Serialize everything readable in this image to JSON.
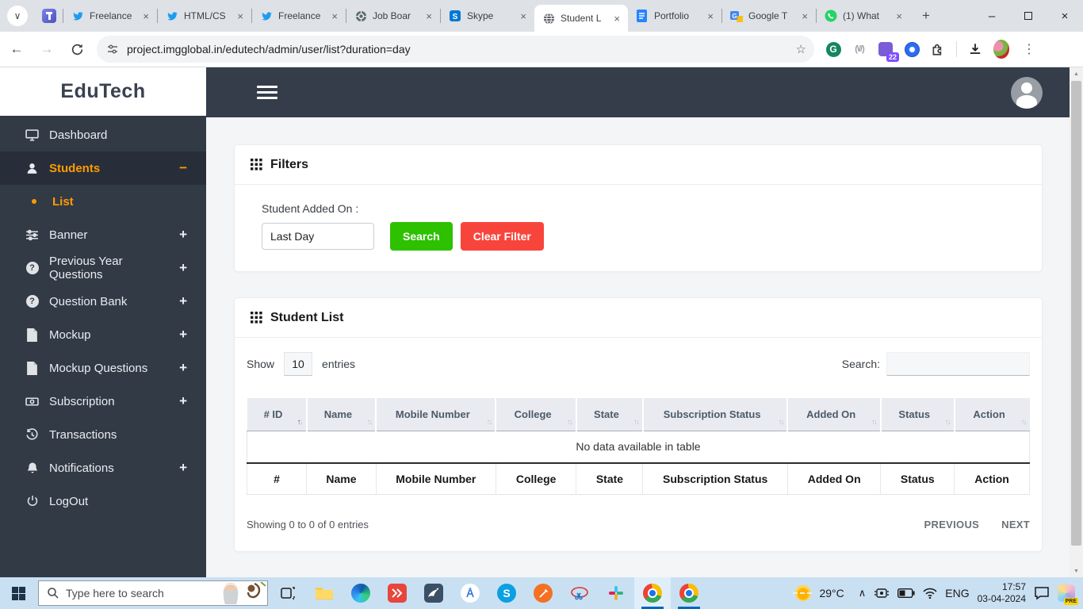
{
  "glyphs": {
    "close": "×",
    "plus": "+",
    "minus": "−",
    "sort_up": "↑",
    "sort_down": "↓",
    "back": "←",
    "forward": "→",
    "star": "☆",
    "kebab": "⋮",
    "min": "–",
    "scroll_up": "▲",
    "scroll_down": "▼",
    "chevron_up": "∧",
    "tab_chevron": "∨",
    "question": "?",
    "skype_s": "S",
    "translate_g": "G",
    "new_tab": "+"
  },
  "browser": {
    "tabs": [
      {
        "label": "Freelance",
        "icon": "twitter"
      },
      {
        "label": "HTML/CS",
        "icon": "twitter"
      },
      {
        "label": "Freelance",
        "icon": "twitter"
      },
      {
        "label": "Job Boar",
        "icon": "chatgpt"
      },
      {
        "label": "Skype",
        "icon": "skype"
      },
      {
        "label": "Student L",
        "icon": "globe",
        "active": true
      },
      {
        "label": "Portfolio",
        "icon": "docs"
      },
      {
        "label": "Google T",
        "icon": "translate"
      },
      {
        "label": "(1) What",
        "icon": "whatsapp"
      }
    ],
    "url": "project.imgglobal.in/edutech/admin/user/list?duration=day",
    "extension_badge": "22"
  },
  "sidebar": {
    "logo": "EduTech",
    "items": [
      {
        "label": "Dashboard"
      },
      {
        "label": "Students",
        "expander": "−"
      },
      {
        "label": "List"
      },
      {
        "label": "Banner",
        "expander": "+"
      },
      {
        "label": "Previous Year Questions",
        "expander": "+"
      },
      {
        "label": "Question Bank",
        "expander": "+"
      },
      {
        "label": "Mockup",
        "expander": "+"
      },
      {
        "label": "Mockup Questions",
        "expander": "+"
      },
      {
        "label": "Subscription",
        "expander": "+"
      },
      {
        "label": "Transactions"
      },
      {
        "label": "Notifications",
        "expander": "+"
      },
      {
        "label": "LogOut"
      }
    ]
  },
  "filters": {
    "title": "Filters",
    "label": "Student Added On :",
    "value": "Last Day",
    "search_button": "Search",
    "clear_button": "Clear Filter"
  },
  "list": {
    "title": "Student List",
    "show_label": "Show",
    "page_size": "10",
    "entries_label": "entries",
    "search_label": "Search:",
    "columns": [
      "# ID",
      "Name",
      "Mobile Number",
      "College",
      "State",
      "Subscription Status",
      "Added On",
      "Status",
      "Action"
    ],
    "footer_columns": [
      "#",
      "Name",
      "Mobile Number",
      "College",
      "State",
      "Subscription Status",
      "Added On",
      "Status",
      "Action"
    ],
    "empty_message": "No data available in table",
    "info": "Showing 0 to 0 of 0 entries",
    "prev": "PREVIOUS",
    "next": "NEXT"
  },
  "taskbar": {
    "search_placeholder": "Type here to search",
    "temperature": "29°C",
    "language": "ENG",
    "time": "17:57",
    "date": "03-04-2024",
    "copilot_badge": "PRE"
  },
  "colors": {
    "accent_orange": "#ff9b00",
    "button_green": "#2dc100",
    "button_red": "#f8453c",
    "sidebar_bg": "#323a46",
    "header_bg": "#353d4a",
    "table_head_bg": "#e9ebf1"
  }
}
